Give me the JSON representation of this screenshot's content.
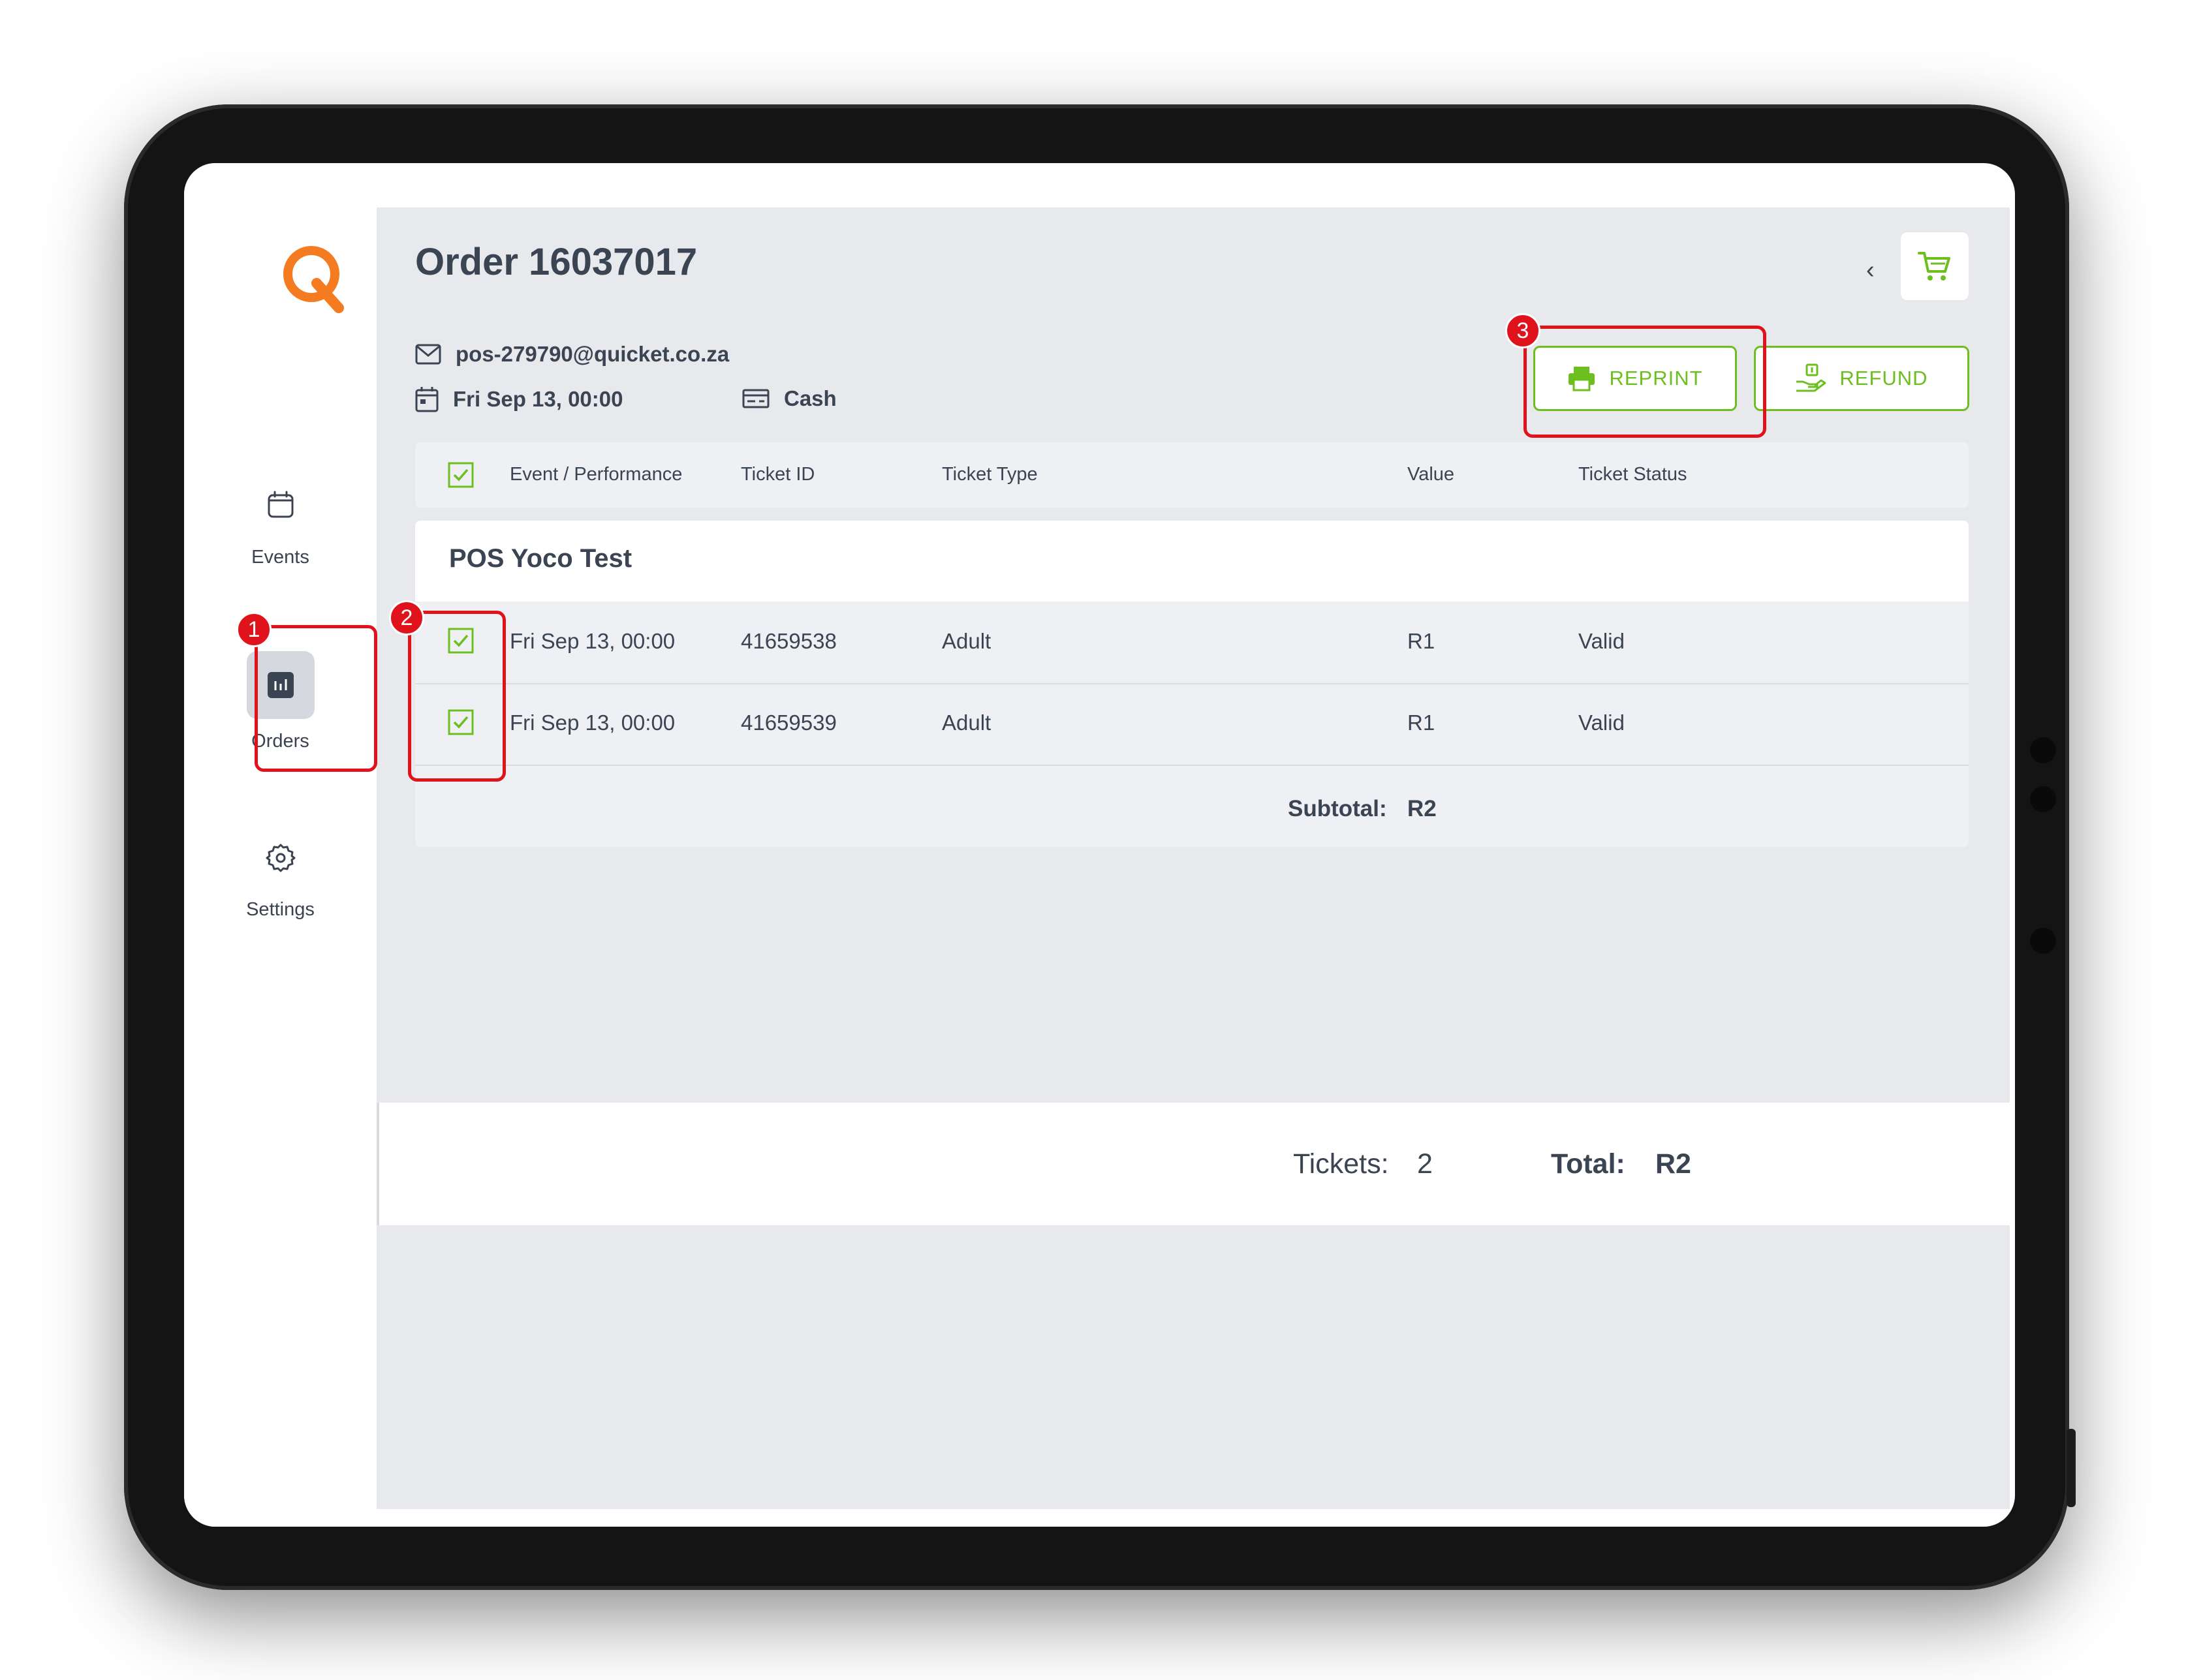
{
  "order": {
    "title": "Order 16037017",
    "email": "pos-279790@quicket.co.za",
    "date": "Fri Sep 13, 00:00",
    "payment": "Cash"
  },
  "nav": {
    "events": "Events",
    "orders": "Orders",
    "settings": "Settings"
  },
  "actions": {
    "reprint": "REPRINT",
    "refund": "REFUND"
  },
  "table": {
    "headers": [
      "Event / Performance",
      "Ticket ID",
      "Ticket Type",
      "Value",
      "Ticket Status"
    ],
    "event_name": "POS Yoco Test",
    "rows": [
      {
        "performance": "Fri Sep 13, 00:00",
        "ticket_id": "41659538",
        "type": "Adult",
        "value": "R1",
        "status": "Valid"
      },
      {
        "performance": "Fri Sep 13, 00:00",
        "ticket_id": "41659539",
        "type": "Adult",
        "value": "R1",
        "status": "Valid"
      }
    ],
    "subtotal_label": "Subtotal:",
    "subtotal_value": "R2"
  },
  "footer": {
    "tickets_label": "Tickets:",
    "tickets_value": "2",
    "total_label": "Total:",
    "total_value": "R2"
  },
  "annotations": [
    "1",
    "2",
    "3"
  ],
  "colors": {
    "accent_green": "#6cbf1e",
    "logo_orange": "#f47b20",
    "annotation_red": "#e0121b"
  }
}
